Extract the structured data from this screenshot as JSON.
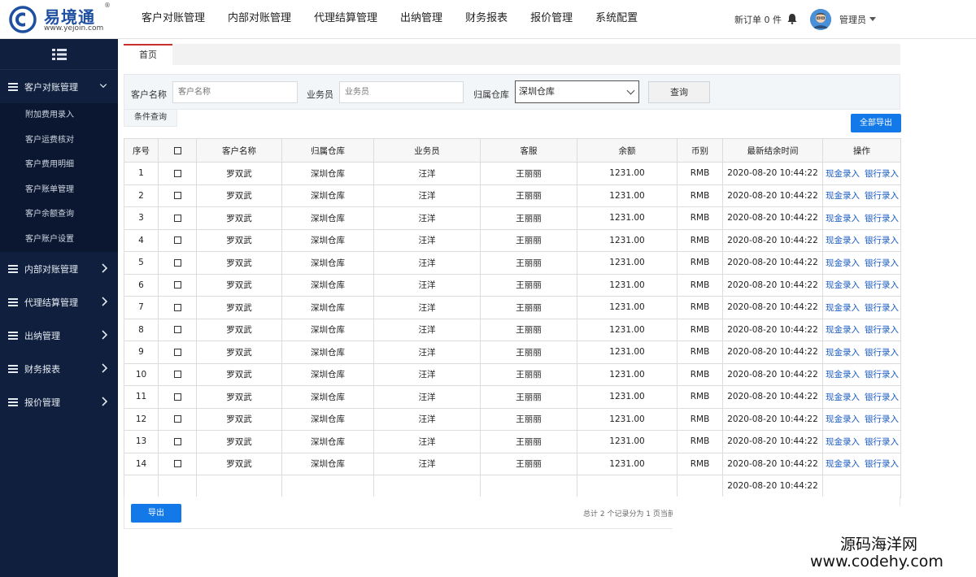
{
  "brand": {
    "name": "易境通",
    "url": "www.yejoin.com",
    "reg": "®",
    "color": "#1e4fa0"
  },
  "topnav": [
    "客户对账管理",
    "内部对账管理",
    "代理结算管理",
    "出纳管理",
    "财务报表",
    "报价管理",
    "系统配置"
  ],
  "header": {
    "new_orders": "新订单 0 件",
    "user": "管理员"
  },
  "sidebar": {
    "groups": [
      {
        "label": "客户对账管理",
        "expanded": true,
        "items": [
          "附加费用录入",
          "客户运费核对",
          "客户费用明细",
          "客户账单管理",
          "客户余额查询",
          "客户账户设置"
        ]
      },
      {
        "label": "内部对账管理"
      },
      {
        "label": "代理结算管理"
      },
      {
        "label": "出纳管理"
      },
      {
        "label": "财务报表"
      },
      {
        "label": "报价管理"
      }
    ]
  },
  "tabs": {
    "home": "首页"
  },
  "filter": {
    "customer_label": "客户名称",
    "customer_placeholder": "客户名称",
    "sales_label": "业务员",
    "sales_placeholder": "业务员",
    "warehouse_label": "归属仓库",
    "warehouse_value": "深圳仓库",
    "query": "查询",
    "cond_tab": "条件查询",
    "export_all": "全部导出"
  },
  "table": {
    "headers": [
      "序号",
      "☐",
      "客户名称",
      "归属仓库",
      "业务员",
      "客服",
      "余额",
      "币别",
      "最新结余时间",
      "操作"
    ],
    "row_template": {
      "customer": "罗双武",
      "warehouse": "深圳仓库",
      "sales": "汪洋",
      "service": "王丽丽",
      "balance": "1231.00",
      "currency": "RMB",
      "time": "2020-08-20  10:44:22",
      "act_cash": "现金录入",
      "act_bank": "银行录入"
    },
    "row_count": 14,
    "summary_time": "2020-08-20  10:44:22"
  },
  "footer": {
    "export": "导出",
    "pager": "总计 2 个记录分为 1 页当前"
  },
  "watermark": {
    "cn": "源码海洋网",
    "url": "www.codehy.com"
  },
  "colors": {
    "sidebar": "#0f1f3d",
    "primary": "#1479e8",
    "link": "#1a5bc4",
    "tab_accent": "#c9302c"
  }
}
